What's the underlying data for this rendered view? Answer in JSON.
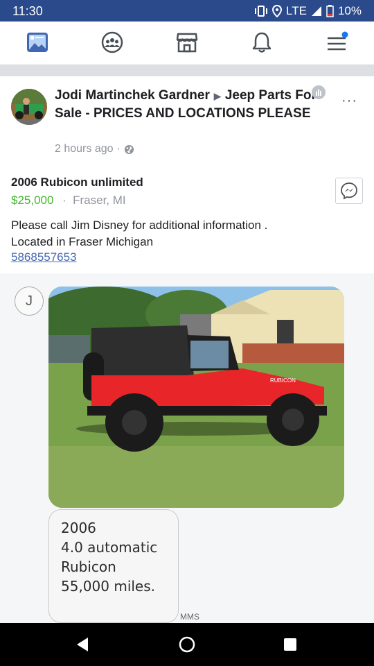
{
  "status_bar": {
    "time": "11:30",
    "network": "LTE",
    "battery": "10%"
  },
  "nav": {
    "icons": [
      "news-feed-icon",
      "groups-icon",
      "marketplace-icon",
      "notifications-icon",
      "menu-icon"
    ]
  },
  "post": {
    "author": "Jodi Martinchek Gardner",
    "group": "Jeep Parts For Sale - PRICES AND LOCATIONS PLEASE",
    "time": "2 hours ago",
    "separator": "·",
    "listing_title": "2006 Rubicon unlimited",
    "price": "$25,000",
    "price_separator": "·",
    "location": "Fraser, MI",
    "description_line1": "Please call Jim Disney for additional information .",
    "description_line2": "Located in Fraser Michigan",
    "phone": "5868557653",
    "more": "···"
  },
  "mms": {
    "contact_initial": "J",
    "message_lines": [
      "2006",
      "4.0 automatic",
      "Rubicon",
      "55,000 miles."
    ],
    "label": "MMS"
  },
  "colors": {
    "status_bar": "#2b4a8b",
    "price": "#42b72a",
    "link": "#4267b2",
    "jeep_red": "#e8262a"
  }
}
